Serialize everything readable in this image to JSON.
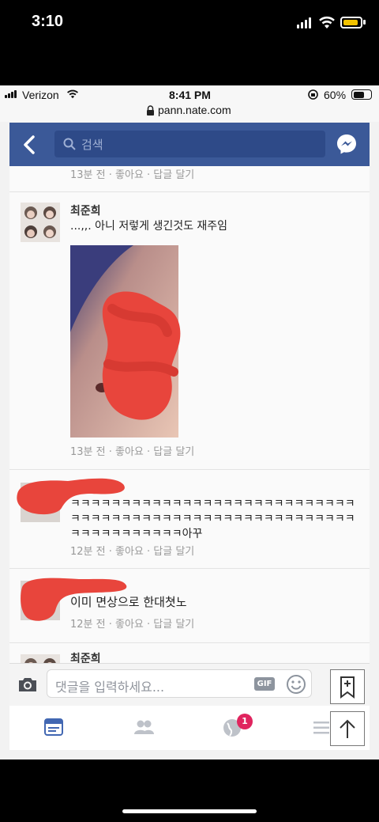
{
  "device": {
    "time": "3:10"
  },
  "browser": {
    "carrier": "Verizon",
    "time": "8:41 PM",
    "battery": "60%",
    "url": "pann.nate.com"
  },
  "header": {
    "search_placeholder": "검색"
  },
  "comments": [
    {
      "meta": "13분 전 · 좋아요 · 답글 달기"
    },
    {
      "name": "최준희",
      "text": "...,,. 아니 저렇게 생긴것도 재주임",
      "meta": "13분 전 · 좋아요 · 답글 달기"
    },
    {
      "text": "ㅋㅋㅋㅋㅋㅋㅋㅋㅋㅋㅋㅋㅋㅋㅋㅋㅋㅋㅋㅋㅋㅋㅋㅋㅋㅋㅋㅋㅋㅋㅋㅋㅋㅋㅋㅋㅋㅋㅋㅋㅋㅋㅋㅋㅋㅋㅋㅋㅋㅋㅋㅋㅋㅋㅋㅋㅋㅋㅋㅋㅋㅋㅋㅋㅋㅋㅋ아꾸",
      "meta": "12분 전 · 좋아요 · 답글 달기"
    },
    {
      "text": "이미 면상으로 한대쳣노",
      "meta": "12분 전 · 좋아요 · 답글 달기"
    },
    {
      "name": "최준희"
    }
  ],
  "input": {
    "placeholder": "댓글을 입력하세요...",
    "gif_label": "GIF"
  },
  "tabs": {
    "notification_count": "1"
  },
  "colors": {
    "facebook_blue": "#3b5998",
    "redaction_red": "#e8453c",
    "badge_red": "#e0245e"
  }
}
